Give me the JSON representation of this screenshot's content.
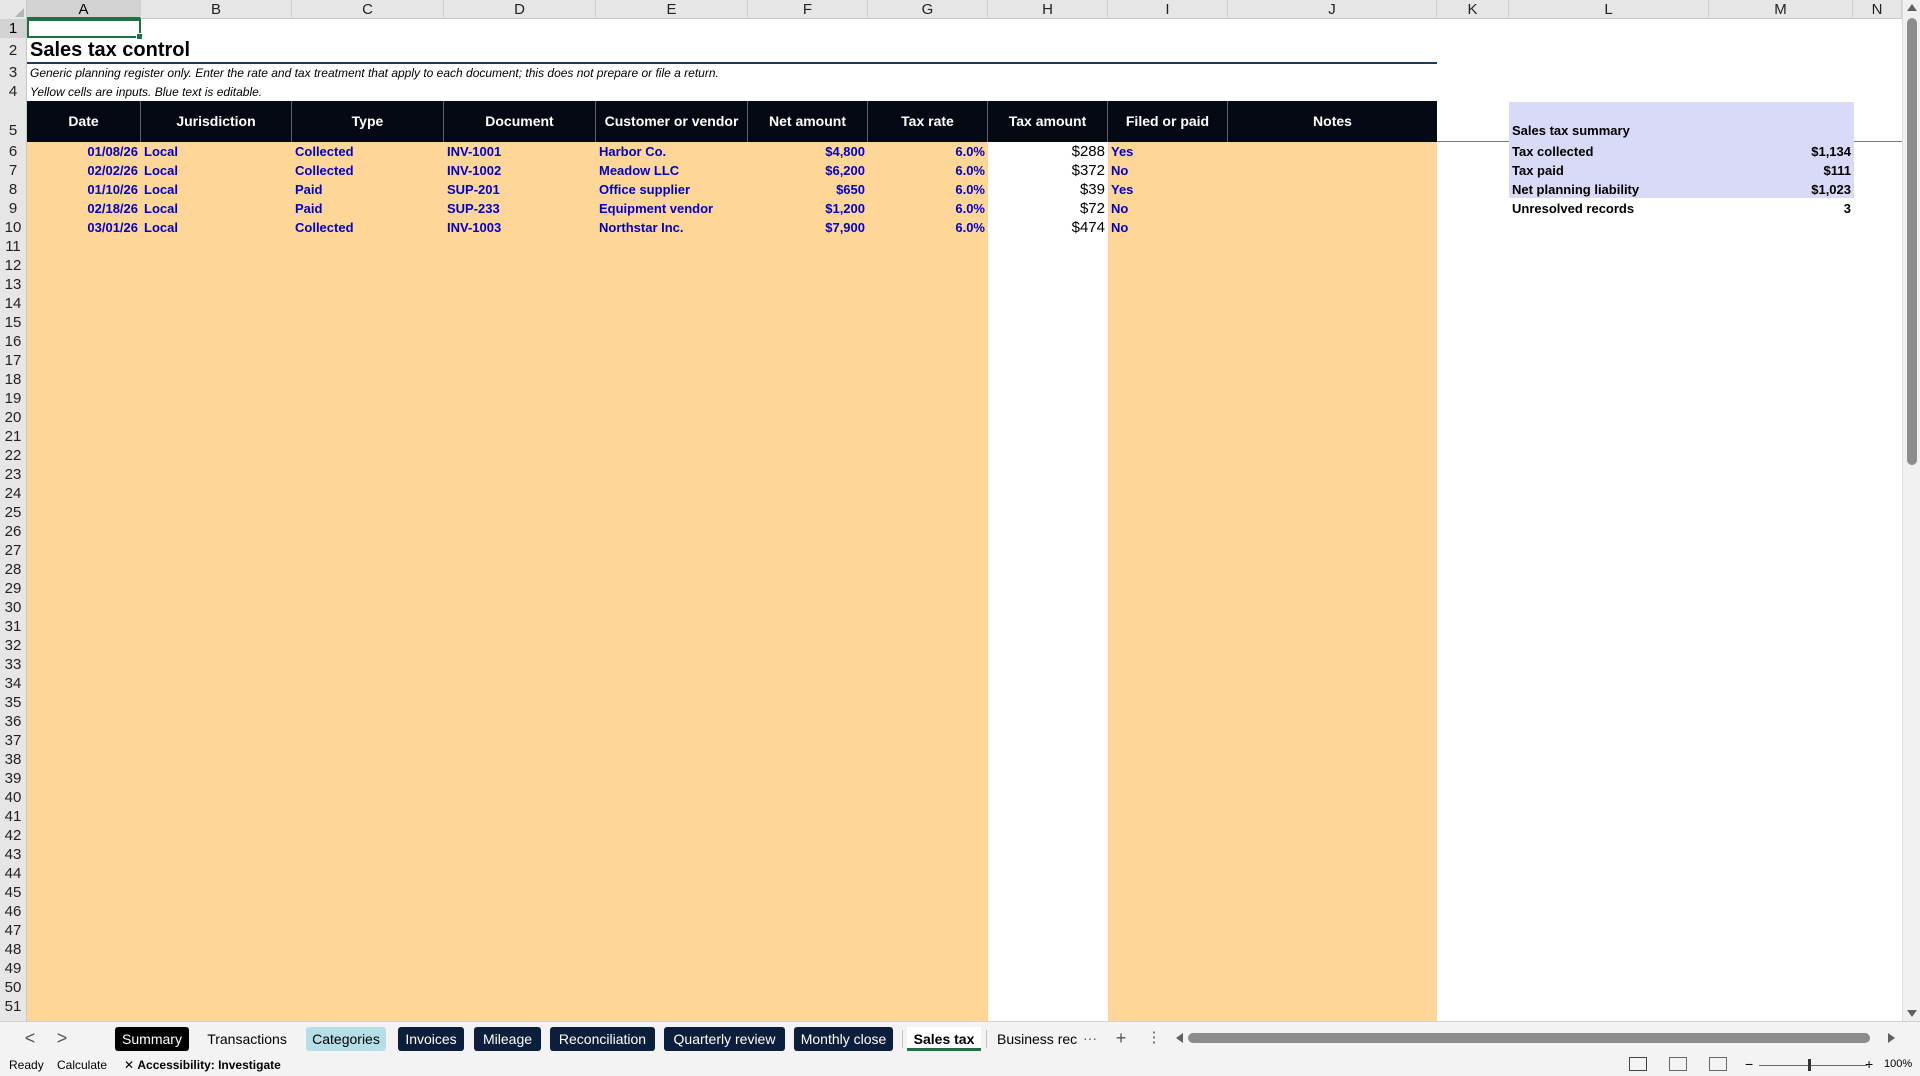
{
  "columns": [
    "A",
    "B",
    "C",
    "D",
    "E",
    "F",
    "G",
    "H",
    "I",
    "J",
    "K",
    "L",
    "M",
    "N"
  ],
  "rows": [
    "1",
    "2",
    "3",
    "4",
    "5",
    "6",
    "7",
    "8",
    "9",
    "10",
    "11",
    "12",
    "13",
    "14",
    "15",
    "16",
    "17",
    "18",
    "19",
    "20",
    "21",
    "22",
    "23",
    "24",
    "25",
    "26",
    "27",
    "28",
    "29",
    "30",
    "31",
    "32",
    "33",
    "34",
    "35",
    "36",
    "37",
    "38",
    "39",
    "40",
    "41",
    "42",
    "43",
    "44",
    "45",
    "46",
    "47",
    "48",
    "49",
    "50",
    "51"
  ],
  "sheet": {
    "title": "Sales tax control",
    "note1": "Generic planning register only. Enter the rate and tax treatment that apply to each document; this does not prepare or file a return.",
    "note2": "Yellow cells are inputs. Blue text is editable.",
    "headers": [
      "Date",
      "Jurisdiction",
      "Type",
      "Document",
      "Customer or vendor",
      "Net amount",
      "Tax rate",
      "Tax amount",
      "Filed or paid",
      "Notes"
    ],
    "records": [
      {
        "date": "01/08/26",
        "jurisdiction": "Local",
        "type": "Collected",
        "document": "INV-1001",
        "party": "Harbor Co.",
        "net": "$4,800",
        "rate": "6.0%",
        "tax": "$288",
        "filed": "Yes",
        "notes": ""
      },
      {
        "date": "02/02/26",
        "jurisdiction": "Local",
        "type": "Collected",
        "document": "INV-1002",
        "party": "Meadow LLC",
        "net": "$6,200",
        "rate": "6.0%",
        "tax": "$372",
        "filed": "No",
        "notes": ""
      },
      {
        "date": "01/10/26",
        "jurisdiction": "Local",
        "type": "Paid",
        "document": "SUP-201",
        "party": "Office supplier",
        "net": "$650",
        "rate": "6.0%",
        "tax": "$39",
        "filed": "Yes",
        "notes": ""
      },
      {
        "date": "02/18/26",
        "jurisdiction": "Local",
        "type": "Paid",
        "document": "SUP-233",
        "party": "Equipment vendor",
        "net": "$1,200",
        "rate": "6.0%",
        "tax": "$72",
        "filed": "No",
        "notes": ""
      },
      {
        "date": "03/01/26",
        "jurisdiction": "Local",
        "type": "Collected",
        "document": "INV-1003",
        "party": "Northstar Inc.",
        "net": "$7,900",
        "rate": "6.0%",
        "tax": "$474",
        "filed": "No",
        "notes": ""
      }
    ],
    "summary": {
      "title": "Sales tax summary",
      "items": [
        {
          "label": "Tax collected",
          "value": "$1,134"
        },
        {
          "label": "Tax paid",
          "value": "$111"
        },
        {
          "label": "Net planning liability",
          "value": "$1,023"
        },
        {
          "label": "Unresolved records",
          "value": "3"
        }
      ]
    }
  },
  "tabs": [
    {
      "label": "Summary",
      "style": "black"
    },
    {
      "label": "Transactions",
      "style": "plain"
    },
    {
      "label": "Categories",
      "style": "teal"
    },
    {
      "label": "Invoices",
      "style": "dark"
    },
    {
      "label": "Mileage",
      "style": "dark"
    },
    {
      "label": "Reconciliation",
      "style": "dark"
    },
    {
      "label": "Quarterly review",
      "style": "dark"
    },
    {
      "label": "Monthly close",
      "style": "dark"
    },
    {
      "label": "Sales tax",
      "style": "active"
    },
    {
      "label": "Business reco",
      "style": "plain"
    }
  ],
  "tab_controls": {
    "prev": "<",
    "next": ">",
    "more": "···",
    "add": "+",
    "options": "⋮"
  },
  "status": {
    "ready": "Ready",
    "calculate": "Calculate",
    "accessibility": "Accessibility: Investigate",
    "zoom": "100%",
    "zoom_minus": "−",
    "zoom_plus": "+"
  },
  "colors": {
    "input_fill": "#fed698",
    "header_bg": "#050913",
    "editable_text": "#0000c8",
    "summary_bg": "#d9d9f8",
    "active_tab_accent": "#1e7145"
  }
}
